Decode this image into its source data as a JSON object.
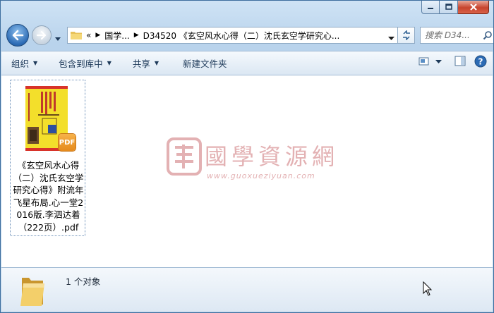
{
  "window": {
    "caption_buttons": [
      "minimize",
      "maximize",
      "close"
    ]
  },
  "address_bar": {
    "overflow": "«",
    "crumbs": [
      "国学...",
      "D34520 《玄空风水心得（二）沈氏玄空学研究心..."
    ]
  },
  "search": {
    "placeholder": "搜索 D34..."
  },
  "toolbar": {
    "organize": "组织",
    "include_library": "包含到库中",
    "share": "共享",
    "new_folder": "新建文件夹"
  },
  "file": {
    "name": "《玄空风水心得（二）沈氏玄空学研究心得》附流年飞星布局.心一堂2016版.李泗达着（222页）.pdf",
    "badge": "PDF"
  },
  "watermark": {
    "cn": "國學資源網",
    "en": "www.guoxueziyuan.com"
  },
  "status": {
    "text": "1 个对象"
  },
  "colors": {
    "chrome_blue": "#b9d3ec",
    "toolbar_text": "#1e3a5a",
    "pdf_badge": "#f0a030",
    "watermark": "#e3b1b3"
  }
}
